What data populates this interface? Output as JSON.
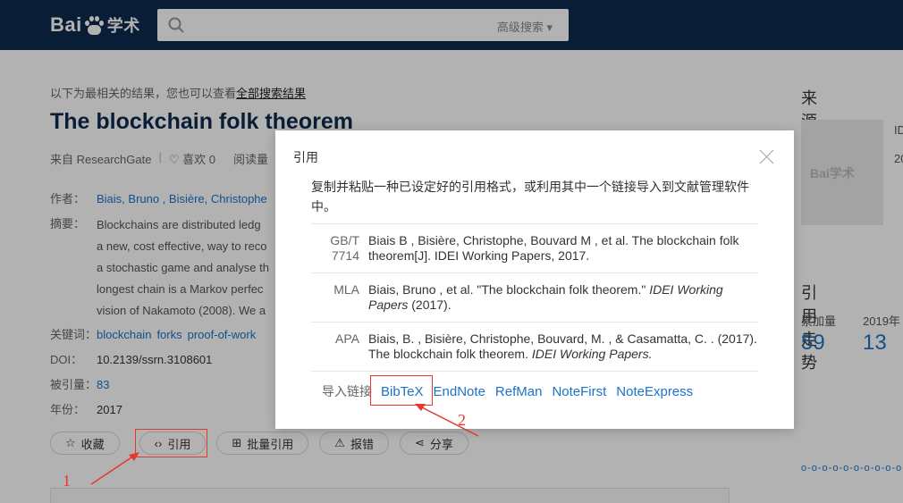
{
  "header": {
    "logo_left": "Bai",
    "logo_mid": "du",
    "logo_right": "学术",
    "search_value": "",
    "advanced_search": "高级搜索"
  },
  "page": {
    "hint_prefix": "以下为最相关的结果，您也可以查看",
    "hint_link": "全部搜索结果",
    "title": "The blockchain folk theorem",
    "source": "来自 ResearchGate",
    "likes": "喜欢 0",
    "reads": "阅读量",
    "authors_label": "作者：",
    "authors": "Biais, Bruno , Bisière, Christophe",
    "abstract_label": "摘要：",
    "abstract_lines": [
      "Blockchains are distributed ledg",
      "a new, cost effective, way to reco",
      "a stochastic game and analyse th",
      "longest chain is a Markov perfec",
      "vision of Nakamoto (2008). We a"
    ],
    "keywords_label": "关键词：",
    "keywords": [
      "blockchain",
      "forks",
      "proof-of-work"
    ],
    "doi_label": "DOI：",
    "doi": "10.2139/ssrn.3108601",
    "cited_label": "被引量：",
    "cited": "83",
    "year_label": "年份：",
    "year": "2017",
    "buttons": {
      "collect": "收藏",
      "cite": "引用",
      "batch_cite": "批量引用",
      "report": "报错",
      "share": "分享"
    }
  },
  "sidebar": {
    "journal_heading": "来源期刊",
    "journal_thumb_text": "Bai学术",
    "journal_name_fragment": "ID",
    "journal_year_fragment": "20",
    "trend_heading": "引用走势",
    "total_label": "累加量",
    "total_value": "59",
    "year_label": "2019年",
    "year_value": "13"
  },
  "modal": {
    "title": "引用",
    "description": "复制并粘贴一种已设定好的引用格式，或利用其中一个链接导入到文献管理软件中。",
    "citations": [
      {
        "format": "GB/T 7714",
        "text": "Biais B , Bisière, Christophe, Bouvard M , et al. The blockchain folk theorem[J]. IDEI Working Papers, 2017."
      },
      {
        "format": "MLA",
        "text_prefix": "Biais, Bruno , et al. \"The blockchain folk theorem.\" ",
        "text_italic": "IDEI Working Papers",
        "text_suffix": " (2017)."
      },
      {
        "format": "APA",
        "text_prefix": "Biais, B. , Bisière, Christophe, Bouvard, M. , & Casamatta, C. . (2017). The blockchain folk theorem. ",
        "text_italic": "IDEI Working Papers.",
        "text_suffix": ""
      }
    ],
    "import_label": "导入链接",
    "import_links": [
      "BibTeX",
      "EndNote",
      "RefMan",
      "NoteFirst",
      "NoteExpress"
    ]
  },
  "annotations": {
    "marker_1": "1",
    "marker_2": "2",
    "color": "#e23a2f"
  },
  "colors": {
    "header_bg": "#0f2a4f",
    "link": "#1a73c9",
    "title": "#0f2a4f"
  }
}
